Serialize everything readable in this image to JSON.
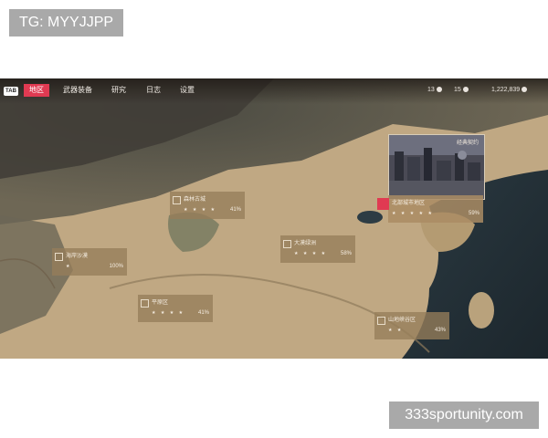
{
  "watermarks": {
    "top": "TG: MYYJJPP",
    "bottom": "333sportunity.com"
  },
  "hud": {
    "tab_key": "TAB",
    "nav": [
      "地区",
      "武器装备",
      "研究",
      "日志",
      "设置"
    ],
    "active_nav": "地区",
    "resources": [
      {
        "value": "13",
        "icon": "fuel-icon"
      },
      {
        "value": "15",
        "icon": "intel-icon"
      },
      {
        "value": "1,222,839",
        "icon": "currency-icon"
      }
    ],
    "colors": {
      "accent": "#e03a52"
    }
  },
  "city_card": {
    "title": "经典契约"
  },
  "regions": [
    {
      "id": "r1",
      "name": "森林古城",
      "stars": "★ ★ ★ ★",
      "pct": "41%"
    },
    {
      "id": "r2",
      "name": "海岸沙漠",
      "stars": "★",
      "pct": "100%"
    },
    {
      "id": "r3",
      "name": "大漠绿洲",
      "stars": "★ ★ ★ ★",
      "pct": "58%"
    },
    {
      "id": "r4",
      "name": "北部城市地区",
      "stars": "★ ★ ★ ★ ★",
      "pct": "59%"
    },
    {
      "id": "r5",
      "name": "平原区",
      "stars": "★ ★ ★ ★",
      "pct": "41%"
    },
    {
      "id": "r6",
      "name": "山地峡谷区",
      "stars": "★ ★",
      "pct": "43%"
    }
  ]
}
